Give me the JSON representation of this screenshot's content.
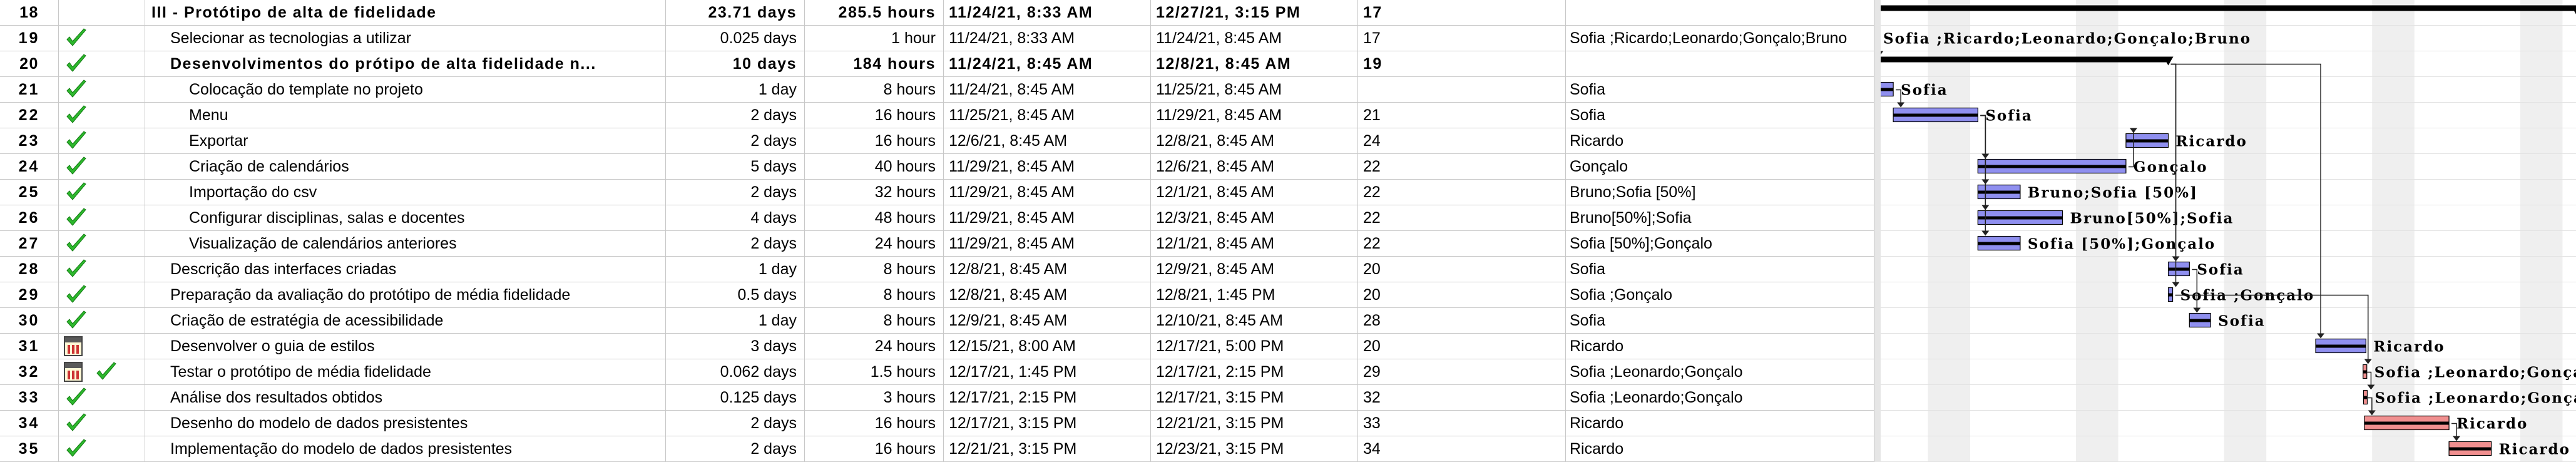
{
  "rows": [
    {
      "id": "18",
      "name": "III - Protótipo de alta de fidelidade",
      "duration": "23.71 days",
      "work": "285.5 hours",
      "start": "11/24/21, 8:33 AM",
      "finish": "12/27/21, 3:15 PM",
      "pred": "17",
      "res": "",
      "summary": true,
      "indent": 0,
      "indicators": []
    },
    {
      "id": "19",
      "name": "Selecionar as tecnologias a utilizar",
      "duration": "0.025 days",
      "work": "1 hour",
      "start": "11/24/21, 8:33 AM",
      "finish": "11/24/21, 8:45 AM",
      "pred": "17",
      "res": "Sofia ;Ricardo;Leonardo;Gonçalo;Bruno",
      "summary": false,
      "indent": 1,
      "indicators": [
        "check"
      ]
    },
    {
      "id": "20",
      "name": "Desenvolvimentos do prótipo de alta fidelidade n...",
      "duration": "10 days",
      "work": "184 hours",
      "start": "11/24/21, 8:45 AM",
      "finish": "12/8/21, 8:45 AM",
      "pred": "19",
      "res": "",
      "summary": true,
      "indent": 1,
      "indicators": [
        "check"
      ]
    },
    {
      "id": "21",
      "name": "Colocação do template no projeto",
      "duration": "1 day",
      "work": "8 hours",
      "start": "11/24/21, 8:45 AM",
      "finish": "11/25/21, 8:45 AM",
      "pred": "",
      "res": "Sofia",
      "summary": false,
      "indent": 2,
      "indicators": [
        "check"
      ]
    },
    {
      "id": "22",
      "name": "Menu",
      "duration": "2 days",
      "work": "16 hours",
      "start": "11/25/21, 8:45 AM",
      "finish": "11/29/21, 8:45 AM",
      "pred": "21",
      "res": "Sofia",
      "summary": false,
      "indent": 2,
      "indicators": [
        "check"
      ]
    },
    {
      "id": "23",
      "name": "Exportar",
      "duration": "2 days",
      "work": "16 hours",
      "start": "12/6/21, 8:45 AM",
      "finish": "12/8/21, 8:45 AM",
      "pred": "24",
      "res": "Ricardo",
      "summary": false,
      "indent": 2,
      "indicators": [
        "check"
      ]
    },
    {
      "id": "24",
      "name": "Criação de calendários",
      "duration": "5 days",
      "work": "40 hours",
      "start": "11/29/21, 8:45 AM",
      "finish": "12/6/21, 8:45 AM",
      "pred": "22",
      "res": "Gonçalo",
      "summary": false,
      "indent": 2,
      "indicators": [
        "check"
      ]
    },
    {
      "id": "25",
      "name": "Importação do csv",
      "duration": "2 days",
      "work": "32 hours",
      "start": "11/29/21, 8:45 AM",
      "finish": "12/1/21, 8:45 AM",
      "pred": "22",
      "res": "Bruno;Sofia [50%]",
      "summary": false,
      "indent": 2,
      "indicators": [
        "check"
      ]
    },
    {
      "id": "26",
      "name": "Configurar disciplinas, salas e docentes",
      "duration": "4 days",
      "work": "48 hours",
      "start": "11/29/21, 8:45 AM",
      "finish": "12/3/21, 8:45 AM",
      "pred": "22",
      "res": "Bruno[50%];Sofia",
      "summary": false,
      "indent": 2,
      "indicators": [
        "check"
      ]
    },
    {
      "id": "27",
      "name": "Visualização de calendários anteriores",
      "duration": "2 days",
      "work": "24 hours",
      "start": "11/29/21, 8:45 AM",
      "finish": "12/1/21, 8:45 AM",
      "pred": "22",
      "res": "Sofia [50%];Gonçalo",
      "summary": false,
      "indent": 2,
      "indicators": [
        "check"
      ]
    },
    {
      "id": "28",
      "name": "Descrição das interfaces criadas",
      "duration": "1 day",
      "work": "8 hours",
      "start": "12/8/21, 8:45 AM",
      "finish": "12/9/21, 8:45 AM",
      "pred": "20",
      "res": "Sofia",
      "summary": false,
      "indent": 1,
      "indicators": [
        "check"
      ]
    },
    {
      "id": "29",
      "name": "Preparação da avaliação do protótipo de média fidelidade",
      "duration": "0.5 days",
      "work": "8 hours",
      "start": "12/8/21, 8:45 AM",
      "finish": "12/8/21, 1:45 PM",
      "pred": "20",
      "res": "Sofia ;Gonçalo",
      "summary": false,
      "indent": 1,
      "indicators": [
        "check"
      ]
    },
    {
      "id": "30",
      "name": "Criação de estratégia de acessibilidade",
      "duration": "1 day",
      "work": "8 hours",
      "start": "12/9/21, 8:45 AM",
      "finish": "12/10/21, 8:45 AM",
      "pred": "28",
      "res": "Sofia",
      "summary": false,
      "indent": 1,
      "indicators": [
        "check"
      ]
    },
    {
      "id": "31",
      "name": "Desenvolver o guia de estilos",
      "duration": "3 days",
      "work": "24 hours",
      "start": "12/15/21, 8:00 AM",
      "finish": "12/17/21, 5:00 PM",
      "pred": "20",
      "res": "Ricardo",
      "summary": false,
      "indent": 1,
      "indicators": [
        "calendar"
      ]
    },
    {
      "id": "32",
      "name": "Testar o protótipo de média fidelidade",
      "duration": "0.062 days",
      "work": "1.5 hours",
      "start": "12/17/21, 1:45 PM",
      "finish": "12/17/21, 2:15 PM",
      "pred": "29",
      "res": "Sofia ;Leonardo;Gonçalo",
      "summary": false,
      "indent": 1,
      "indicators": [
        "calendar",
        "check"
      ]
    },
    {
      "id": "33",
      "name": "Análise dos resultados obtidos",
      "duration": "0.125 days",
      "work": "3 hours",
      "start": "12/17/21, 2:15 PM",
      "finish": "12/17/21, 3:15 PM",
      "pred": "32",
      "res": "Sofia ;Leonardo;Gonçalo",
      "summary": false,
      "indent": 1,
      "indicators": [
        "check"
      ]
    },
    {
      "id": "34",
      "name": "Desenho do modelo de dados presistentes",
      "duration": "2 days",
      "work": "16 hours",
      "start": "12/17/21, 3:15 PM",
      "finish": "12/21/21, 3:15 PM",
      "pred": "33",
      "res": "Ricardo",
      "summary": false,
      "indent": 1,
      "indicators": [
        "check"
      ]
    },
    {
      "id": "35",
      "name": "Implementação do modelo de dados presistentes",
      "duration": "2 days",
      "work": "16 hours",
      "start": "12/21/21, 3:15 PM",
      "finish": "12/23/21, 3:15 PM",
      "pred": "34",
      "res": "Ricardo",
      "summary": false,
      "indent": 1,
      "indicators": [
        "check"
      ]
    }
  ],
  "gantt": [
    {
      "id": "18",
      "start": "11/24/21, 8:33 AM",
      "finish": "12/27/21, 3:15 PM",
      "kind": "summary",
      "label": ""
    },
    {
      "id": "19",
      "start": "11/24/21, 8:33 AM",
      "finish": "11/24/21, 8:45 AM",
      "kind": "task",
      "label": "Sofia ;Ricardo;Leonardo;Gonçalo;Bruno"
    },
    {
      "id": "20",
      "start": "11/24/21, 8:45 AM",
      "finish": "12/8/21, 8:45 AM",
      "kind": "summary",
      "label": ""
    },
    {
      "id": "21",
      "start": "11/24/21, 8:45 AM",
      "finish": "11/25/21, 8:45 AM",
      "kind": "task",
      "label": "Sofia"
    },
    {
      "id": "22",
      "start": "11/25/21, 8:45 AM",
      "finish": "11/29/21, 8:45 AM",
      "kind": "task",
      "label": "Sofia"
    },
    {
      "id": "23",
      "start": "12/6/21, 8:45 AM",
      "finish": "12/8/21, 8:45 AM",
      "kind": "task",
      "label": "Ricardo"
    },
    {
      "id": "24",
      "start": "11/29/21, 8:45 AM",
      "finish": "12/6/21, 8:45 AM",
      "kind": "task",
      "label": "Gonçalo"
    },
    {
      "id": "25",
      "start": "11/29/21, 8:45 AM",
      "finish": "12/1/21, 8:45 AM",
      "kind": "task",
      "label": "Bruno;Sofia [50%]"
    },
    {
      "id": "26",
      "start": "11/29/21, 8:45 AM",
      "finish": "12/3/21, 8:45 AM",
      "kind": "task",
      "label": "Bruno[50%];Sofia"
    },
    {
      "id": "27",
      "start": "11/29/21, 8:45 AM",
      "finish": "12/1/21, 8:45 AM",
      "kind": "task",
      "label": "Sofia [50%];Gonçalo"
    },
    {
      "id": "28",
      "start": "12/8/21, 8:45 AM",
      "finish": "12/9/21, 8:45 AM",
      "kind": "task",
      "label": "Sofia"
    },
    {
      "id": "29",
      "start": "12/8/21, 8:45 AM",
      "finish": "12/8/21, 1:45 PM",
      "kind": "task",
      "label": "Sofia ;Gonçalo"
    },
    {
      "id": "30",
      "start": "12/9/21, 8:45 AM",
      "finish": "12/10/21, 8:45 AM",
      "kind": "task",
      "label": "Sofia"
    },
    {
      "id": "31",
      "start": "12/15/21, 8:00 AM",
      "finish": "12/17/21, 5:00 PM",
      "kind": "task",
      "label": "Ricardo"
    },
    {
      "id": "32",
      "start": "12/17/21, 1:45 PM",
      "finish": "12/17/21, 2:15 PM",
      "kind": "critical",
      "label": "Sofia ;Leonardo;Gonçalo"
    },
    {
      "id": "33",
      "start": "12/17/21, 2:15 PM",
      "finish": "12/17/21, 3:15 PM",
      "kind": "critical",
      "label": "Sofia ;Leonardo;Gonçalo"
    },
    {
      "id": "34",
      "start": "12/17/21, 3:15 PM",
      "finish": "12/21/21, 3:15 PM",
      "kind": "critical",
      "label": "Ricardo"
    },
    {
      "id": "35",
      "start": "12/21/21, 3:15 PM",
      "finish": "12/23/21, 3:15 PM",
      "kind": "critical",
      "label": "Ricardo"
    }
  ],
  "colors": {
    "task": "#8f8fef",
    "critical": "#f08f8f",
    "summary": "#000000",
    "check": "#2db82d",
    "grid": "#c8c8c8",
    "weekend": "#efefef"
  }
}
